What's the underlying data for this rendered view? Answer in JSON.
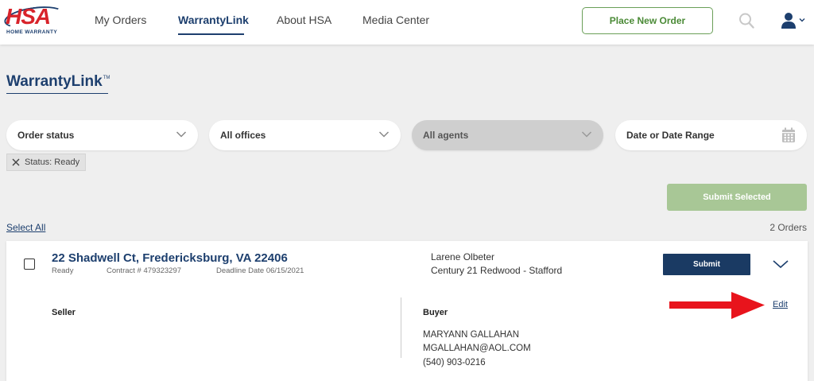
{
  "brand": {
    "logo_text": "HSA",
    "logo_sub": "HOME WARRANTY"
  },
  "nav": {
    "items": [
      {
        "label": "My Orders",
        "active": false
      },
      {
        "label": "WarrantyLink",
        "active": true
      },
      {
        "label": "About HSA",
        "active": false
      },
      {
        "label": "Media Center",
        "active": false
      }
    ],
    "place_order_label": "Place New Order"
  },
  "page": {
    "title": "WarrantyLink",
    "title_mark": "TM"
  },
  "filters": {
    "order_status": "Order status",
    "offices": "All offices",
    "agents": "All agents",
    "date_range": "Date or Date Range"
  },
  "active_filter_chip": "Status: Ready",
  "actions": {
    "submit_selected": "Submit Selected",
    "select_all": "Select All",
    "orders_count": "2 Orders"
  },
  "order": {
    "address": "22 Shadwell Ct, Fredericksburg, VA 22406",
    "status": "Ready",
    "contract": "Contract # 479323297",
    "deadline": "Deadline Date 06/15/2021",
    "agent_name": "Larene Olbeter",
    "agent_office": "Century 21 Redwood - Stafford",
    "submit_label": "Submit",
    "seller_label": "Seller",
    "buyer_label": "Buyer",
    "buyer_name": "MARYANN GALLAHAN",
    "buyer_email": "MGALLAHAN@AOL.COM",
    "buyer_phone": "(540) 903-0216",
    "edit_label": "Edit"
  },
  "colors": {
    "brand_navy": "#1d3f6e",
    "brand_red": "#d8232a",
    "green_outline": "#6a9f58",
    "submit_selected_bg": "#a8c796",
    "submit_bg": "#1a3a63",
    "annotation_arrow": "#e8141c"
  },
  "icons": {
    "search": "search-icon",
    "user": "user-icon",
    "chevron": "chevron-down-icon",
    "calendar": "calendar-icon",
    "close": "close-icon"
  }
}
